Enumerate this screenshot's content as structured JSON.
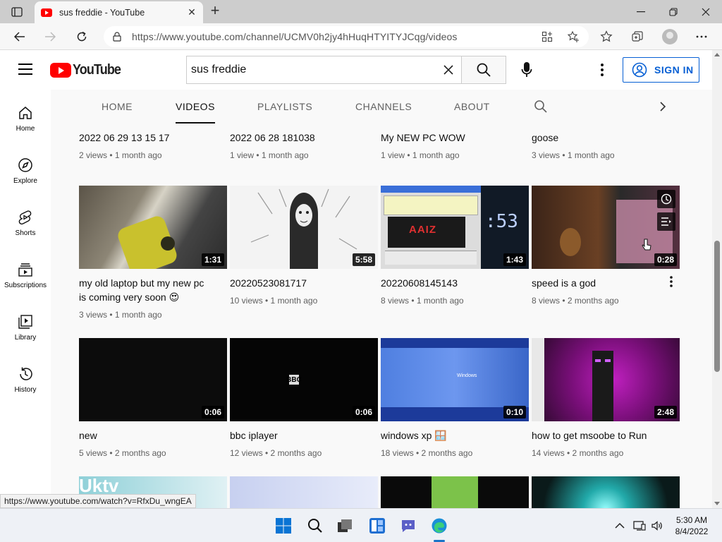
{
  "browser": {
    "tab_title": "sus freddie - YouTube",
    "url": "https://www.youtube.com/channel/UCMV0h2jy4hHuqHTYITYJCqg/videos",
    "status_url": "https://www.youtube.com/watch?v=RfxDu_wngEA"
  },
  "header": {
    "logo_text": "YouTube",
    "search_value": "sus freddie",
    "sign_in_label": "SIGN IN"
  },
  "guide": [
    {
      "label": "Home",
      "icon": "home-icon"
    },
    {
      "label": "Explore",
      "icon": "compass-icon"
    },
    {
      "label": "Shorts",
      "icon": "shorts-icon"
    },
    {
      "label": "Subscriptions",
      "icon": "subscriptions-icon"
    },
    {
      "label": "Library",
      "icon": "library-icon"
    },
    {
      "label": "History",
      "icon": "history-icon"
    }
  ],
  "channel_tabs": [
    {
      "label": "HOME"
    },
    {
      "label": "VIDEOS",
      "active": true
    },
    {
      "label": "PLAYLISTS"
    },
    {
      "label": "CHANNELS"
    },
    {
      "label": "ABOUT"
    }
  ],
  "row0": [
    {
      "title": "2022 06 29 13 15 17",
      "meta": "2 views • 1 month ago"
    },
    {
      "title": "2022 06 28 181038",
      "meta": "1 view • 1 month ago"
    },
    {
      "title": "My NEW PC WOW",
      "meta": "1 view • 1 month ago"
    },
    {
      "title": "goose",
      "meta": "3 views • 1 month ago"
    }
  ],
  "row1": [
    {
      "title": "my old laptop but my new pc is coming very soon 😍",
      "meta": "3 views • 1 month ago",
      "duration": "1:31"
    },
    {
      "title": "20220523081717",
      "meta": "10 views • 1 month ago",
      "duration": "5:58"
    },
    {
      "title": "20220608145143",
      "meta": "8 views • 1 month ago",
      "duration": "1:43"
    },
    {
      "title": "speed is a god",
      "meta": "8 views • 2 months ago",
      "duration": "0:28"
    }
  ],
  "row2": [
    {
      "title": "new",
      "meta": "5 views • 2 months ago",
      "duration": "0:06"
    },
    {
      "title": "bbc iplayer",
      "meta": "12 views • 2 months ago",
      "duration": "0:06"
    },
    {
      "title": "windows xp 🪟",
      "meta": "18 views • 2 months ago",
      "duration": "0:10"
    },
    {
      "title": "how to get msoobe to Run",
      "meta": "14 views • 2 months ago",
      "duration": "2:48"
    }
  ],
  "thumb_text": {
    "bbc": "BBC",
    "uktv": "Uktv",
    "xp": "Windows",
    "clock": ":53",
    "sign": "AAIZ"
  },
  "taskbar": {
    "time": "5:30 AM",
    "date": "8/4/2022"
  },
  "colors": {
    "yt_red": "#ff0000",
    "link_blue": "#065fd4"
  }
}
